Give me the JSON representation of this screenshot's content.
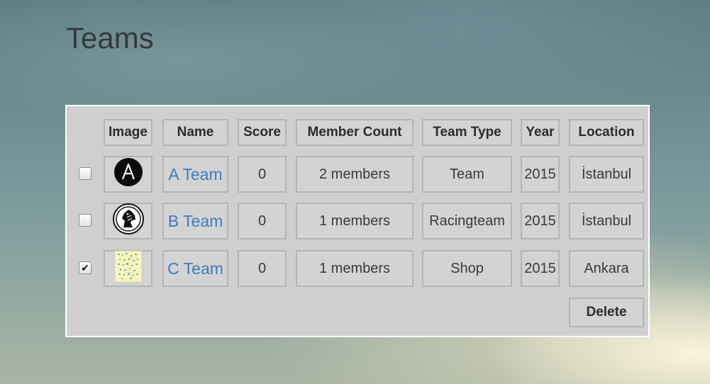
{
  "page": {
    "title": "Teams"
  },
  "table": {
    "headers": [
      "Image",
      "Name",
      "Score",
      "Member Count",
      "Team Type",
      "Year",
      "Location"
    ],
    "rows": [
      {
        "checked": false,
        "image": "a-letter-logo",
        "name": "A Team",
        "score": "0",
        "members": "2 members",
        "type": "Team",
        "year": "2015",
        "location": "İstanbul"
      },
      {
        "checked": false,
        "image": "horse-head-logo",
        "name": "B Team",
        "score": "0",
        "members": "1 members",
        "type": "Racingteam",
        "year": "2015",
        "location": "İstanbul"
      },
      {
        "checked": true,
        "image": "shop-thumbnail",
        "name": "C Team",
        "score": "0",
        "members": "1 members",
        "type": "Shop",
        "year": "2015",
        "location": "Ankara"
      }
    ]
  },
  "actions": {
    "delete_label": "Delete"
  },
  "colors": {
    "link": "#3d7cc0",
    "panel": "#cfcfcf",
    "cell_border": "#b5b5b5"
  }
}
